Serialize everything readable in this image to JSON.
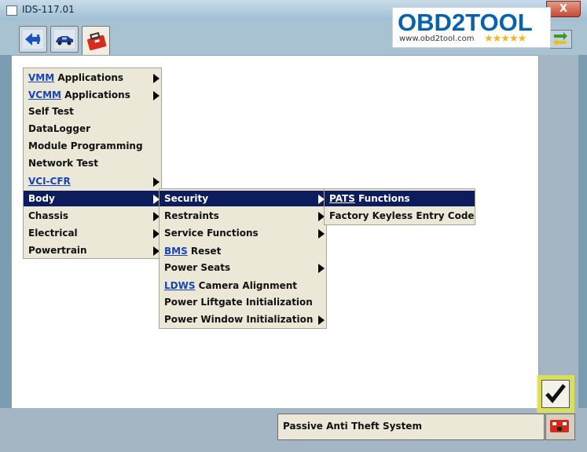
{
  "window": {
    "title": "IDS-117.01",
    "close_label": "X"
  },
  "logo": {
    "brand": "OBD2TOOL",
    "url": "www.obd2tool.com",
    "stars": "★★★★★"
  },
  "tabs": [
    {
      "name": "connect-tab",
      "icon": "connector-icon"
    },
    {
      "name": "vehicle-tab",
      "icon": "car-icon"
    },
    {
      "name": "toolbox-tab",
      "icon": "toolbox-icon",
      "active": true
    }
  ],
  "main_menu": [
    {
      "key": "VMM",
      "rest": " Applications",
      "submenu": true
    },
    {
      "key": "VCMM",
      "rest": " Applications",
      "submenu": true
    },
    {
      "key": "",
      "rest": "Self Test",
      "submenu": false
    },
    {
      "key": "",
      "rest": "DataLogger",
      "submenu": false
    },
    {
      "key": "",
      "rest": "Module Programming",
      "submenu": false
    },
    {
      "key": "",
      "rest": "Network Test",
      "submenu": false
    },
    {
      "key": "VCI-CFR",
      "rest": "",
      "submenu": true
    },
    {
      "key": "",
      "rest": "Body",
      "submenu": true,
      "selected": true
    },
    {
      "key": "",
      "rest": "Chassis",
      "submenu": true
    },
    {
      "key": "",
      "rest": "Electrical",
      "submenu": true
    },
    {
      "key": "",
      "rest": "Powertrain",
      "submenu": true
    }
  ],
  "body_menu": [
    {
      "key": "",
      "rest": "Security",
      "submenu": true,
      "selected": true
    },
    {
      "key": "",
      "rest": "Restraints",
      "submenu": true
    },
    {
      "key": "",
      "rest": "Service Functions",
      "submenu": true
    },
    {
      "key": "BMS",
      "rest": " Reset",
      "submenu": false
    },
    {
      "key": "",
      "rest": "Power Seats",
      "submenu": true
    },
    {
      "key": "LDWS",
      "rest": " Camera Alignment",
      "submenu": false
    },
    {
      "key": "",
      "rest": "Power Liftgate Initialization",
      "submenu": false
    },
    {
      "key": "",
      "rest": "Power Window Initialization",
      "submenu": true
    }
  ],
  "security_menu": [
    {
      "key": "PATS",
      "rest": " Functions",
      "submenu": false,
      "selected": true
    },
    {
      "key": "",
      "rest": "Factory Keyless Entry Code",
      "submenu": false
    }
  ],
  "status": {
    "text": "Passive Anti Theft System"
  }
}
